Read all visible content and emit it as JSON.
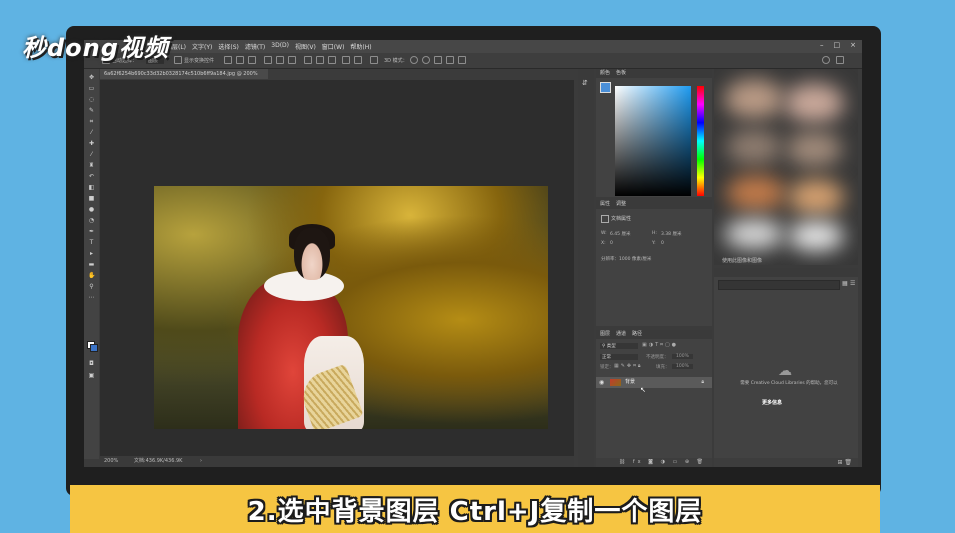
{
  "brand": {
    "logo_text": "秒dong视频"
  },
  "menubar": {
    "items": [
      "图层(L)",
      "文字(Y)",
      "选择(S)",
      "滤镜(T)",
      "3D(D)",
      "视图(V)",
      "窗口(W)",
      "帮助(H)"
    ],
    "window_controls": [
      "–",
      "□",
      "×"
    ]
  },
  "options_bar": {
    "auto_select_label": "自动选择：",
    "auto_select_value": "图层",
    "transform_label": "显示变换控件",
    "mode_3d_label": "3D 模式："
  },
  "document": {
    "tab_title": "6a62f6254b690c33d32b0328174c510b6ff9a184.jpg @ 200%(RGB/8)",
    "status_zoom": "200%",
    "status_doc": "文档:436.9K/436.9K"
  },
  "color_panel": {
    "tabs": [
      "颜色",
      "色板"
    ]
  },
  "properties_panel": {
    "tabs": [
      "属性",
      "调整"
    ],
    "title": "文档属性",
    "w_label": "W:",
    "w_value": "6.45 厘米",
    "h_label": "H:",
    "h_value": "3.38 厘米",
    "x_label": "X:",
    "x_value": "0",
    "y_label": "Y:",
    "y_value": "0",
    "resolution": "分辨率：1000 像素/厘米"
  },
  "layers_panel": {
    "tabs": [
      "图层",
      "通道",
      "路径"
    ],
    "kind_filter": "类型",
    "blend_mode": "正常",
    "opacity_label": "不透明度：",
    "opacity_value": "100%",
    "lock_label": "锁定：",
    "fill_label": "填充：",
    "fill_value": "100%",
    "layers": [
      {
        "name": "背景",
        "visible": true,
        "locked": true
      }
    ]
  },
  "libraries_panel": {
    "blurred_caption": "使用此图像和图像",
    "message": "需要 Creative Cloud Libraries 的帮助，您可以",
    "link": "更多信息"
  },
  "caption": {
    "text": "2.选中背景图层 Ctrl+J复制一个图层"
  },
  "colors": {
    "background": "#5fb3e3",
    "banner": "#f6c542",
    "ps_dark": "#3b3b3b"
  }
}
